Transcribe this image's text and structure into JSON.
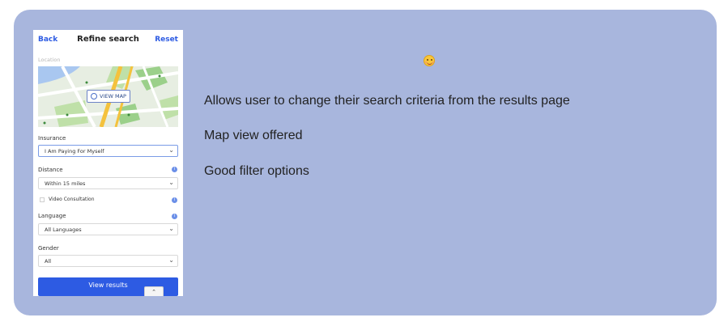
{
  "panel": {
    "header": {
      "back": "Back",
      "title": "Refine search",
      "reset": "Reset"
    },
    "location_label": "Location",
    "map": {
      "button": "VIEW MAP"
    },
    "insurance": {
      "label": "Insurance",
      "value": "I Am Paying For Myself"
    },
    "distance": {
      "label": "Distance",
      "value": "Within 15 miles"
    },
    "video": {
      "label": "Video Consultation",
      "checked": false
    },
    "language": {
      "label": "Language",
      "value": "All Languages"
    },
    "gender": {
      "label": "Gender",
      "value": "All"
    },
    "button": "View results",
    "colors": {
      "accent": "#2d5be3",
      "background": "#a8b6dd"
    }
  },
  "emoji": "smiling-face-icon",
  "notes": [
    "Allows user to change their search criteria from the results page",
    "Map view offered",
    "Good filter options"
  ]
}
